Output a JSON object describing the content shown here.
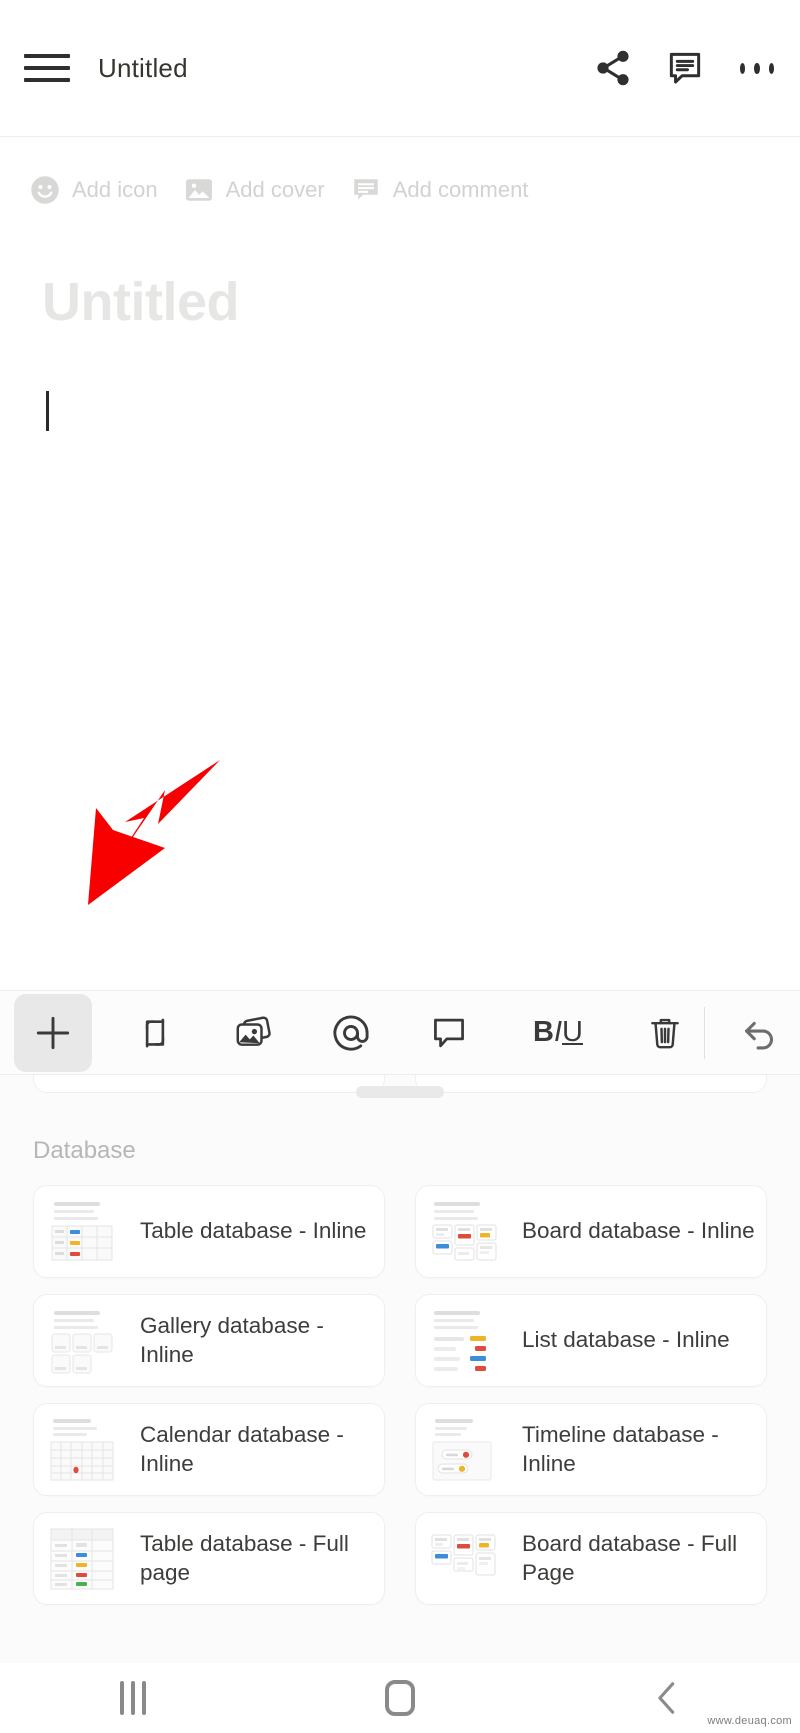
{
  "appbar": {
    "title": "Untitled",
    "menu_icon": "hamburger-menu-icon",
    "share_icon": "share-icon",
    "comment_icon": "comment-icon",
    "more_icon": "more-options-icon"
  },
  "page": {
    "meta_actions": [
      {
        "label": "Add icon",
        "icon": "smiley-face-icon"
      },
      {
        "label": "Add cover",
        "icon": "image-icon"
      },
      {
        "label": "Add comment",
        "icon": "comment-bubble-icon"
      }
    ],
    "title_placeholder": "Untitled",
    "body_text": ""
  },
  "annotation": {
    "arrow_color": "#f80000",
    "arrow_points_to": "add-block-button"
  },
  "toolbar": {
    "items": [
      {
        "name": "add-block-button",
        "icon": "plus-icon",
        "label": "+",
        "active": true
      },
      {
        "name": "turn-into-button",
        "icon": "transform-arrows-icon",
        "label": ""
      },
      {
        "name": "image-button",
        "icon": "photos-icon",
        "label": ""
      },
      {
        "name": "mention-button",
        "icon": "at-sign-icon",
        "label": ""
      },
      {
        "name": "comment-button",
        "icon": "speech-bubble-icon",
        "label": ""
      },
      {
        "name": "text-format-button",
        "icon": "bold-italic-underline-icon",
        "label": "BIU"
      },
      {
        "name": "delete-button",
        "icon": "trash-icon",
        "label": ""
      },
      {
        "name": "undo-button",
        "icon": "undo-arrow-icon",
        "label": ""
      },
      {
        "name": "close-toolbar-button",
        "icon": "close-x-icon",
        "label": ""
      }
    ],
    "format_b": "B",
    "format_i": "I",
    "format_u": "U"
  },
  "sheet": {
    "section_title": "Database",
    "cards": [
      {
        "label": "Table database - Inline",
        "thumb": "table-thumb"
      },
      {
        "label": "Board database - Inline",
        "thumb": "board-thumb"
      },
      {
        "label": "Gallery database - Inline",
        "thumb": "gallery-thumb"
      },
      {
        "label": "List database - Inline",
        "thumb": "list-thumb"
      },
      {
        "label": "Calendar database - Inline",
        "thumb": "calendar-thumb"
      },
      {
        "label": "Timeline database - Inline",
        "thumb": "timeline-thumb"
      },
      {
        "label": "Table database - Full page",
        "thumb": "table-full-thumb"
      },
      {
        "label": "Board database - Full Page",
        "thumb": "board-full-thumb"
      }
    ]
  },
  "navbar": {
    "recents_label": "recent-apps",
    "home_label": "home",
    "back_label": "back"
  },
  "watermark": "www.deuaq.com",
  "colors": {
    "accent_red": "#f80000",
    "text_primary": "#37352f",
    "text_muted": "#b6b6b4",
    "surface": "#ffffff",
    "sheet_bg": "#fbfbfb"
  }
}
